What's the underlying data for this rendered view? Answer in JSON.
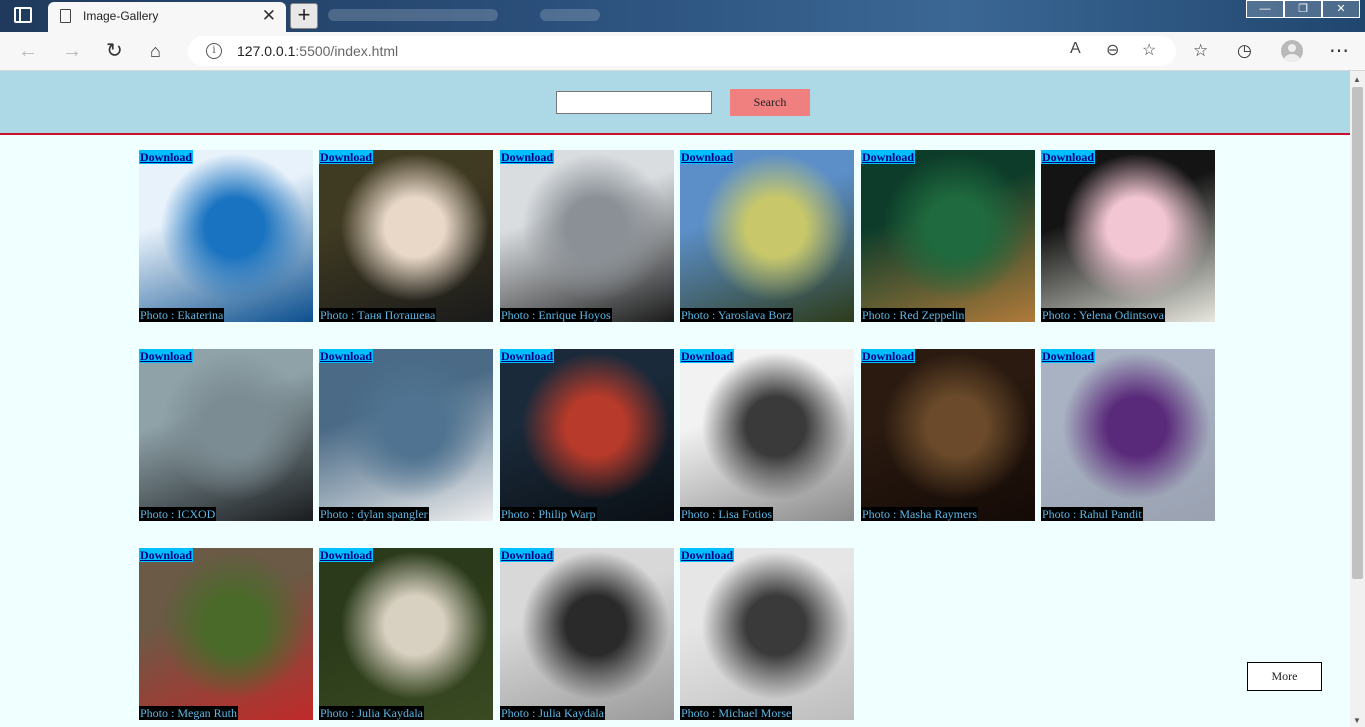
{
  "browser": {
    "tab_title": "Image-Gallery",
    "tab_close": "✕",
    "new_tab": "+",
    "url_host": "127.0.0.1",
    "url_rest": ":5500/index.html",
    "window_controls": [
      "—",
      "❐",
      "✕"
    ]
  },
  "search": {
    "value": "",
    "button_label": "Search"
  },
  "gallery": {
    "download_label": "Download",
    "photos": [
      {
        "credit": "Photo : Ekaterina",
        "colors": [
          "#e8f2fb",
          "#1a73c0",
          "#0b4f8e"
        ]
      },
      {
        "credit": "Photo : Таня Поташева",
        "colors": [
          "#3f3a22",
          "#e9d8c8",
          "#1a1a1a"
        ]
      },
      {
        "credit": "Photo : Enrique Hoyos",
        "colors": [
          "#d9dde0",
          "#8a9096",
          "#1b1b1b"
        ]
      },
      {
        "credit": "Photo : Yaroslava Borz",
        "colors": [
          "#5c8fc8",
          "#c8c86a",
          "#2d3b1a"
        ]
      },
      {
        "credit": "Photo : Red Zeppelin",
        "colors": [
          "#0d3d2a",
          "#1f6a3e",
          "#b07a3a"
        ]
      },
      {
        "credit": "Photo : Yelena Odintsova",
        "colors": [
          "#141414",
          "#f2c6d3",
          "#e8e8e0"
        ]
      },
      {
        "credit": "Photo : ICXOD",
        "colors": [
          "#8ea2a8",
          "#7b8c92",
          "#1a1c1e"
        ]
      },
      {
        "credit": "Photo : dylan spangler",
        "colors": [
          "#4a6a86",
          "#4f7390",
          "#f0f0f0"
        ]
      },
      {
        "credit": "Photo : Philip Warp",
        "colors": [
          "#1a2a3a",
          "#b83a2a",
          "#0a0f14"
        ]
      },
      {
        "credit": "Photo : Lisa Fotios",
        "colors": [
          "#f2f2f2",
          "#3a3a3a",
          "#8a8a8a"
        ]
      },
      {
        "credit": "Photo : Masha Raymers",
        "colors": [
          "#2a1a10",
          "#6a4a2a",
          "#140a06"
        ]
      },
      {
        "credit": "Photo : Rahul Pandit",
        "colors": [
          "#a8b2c2",
          "#5a2a7a",
          "#9aa2b2"
        ]
      },
      {
        "credit": "Photo : Megan Ruth",
        "colors": [
          "#6a5a46",
          "#4a6a2a",
          "#c02a2a"
        ]
      },
      {
        "credit": "Photo : Julia Kaydala",
        "colors": [
          "#2a3a1a",
          "#d8d0c0",
          "#3a4a22"
        ]
      },
      {
        "credit": "Photo : Julia Kaydala",
        "colors": [
          "#d8d8d8",
          "#2a2a2a",
          "#9a9a9a"
        ]
      },
      {
        "credit": "Photo : Michael Morse",
        "colors": [
          "#e6e6e6",
          "#3a3a3a",
          "#bdbdbd"
        ]
      }
    ]
  },
  "more_button": "More"
}
